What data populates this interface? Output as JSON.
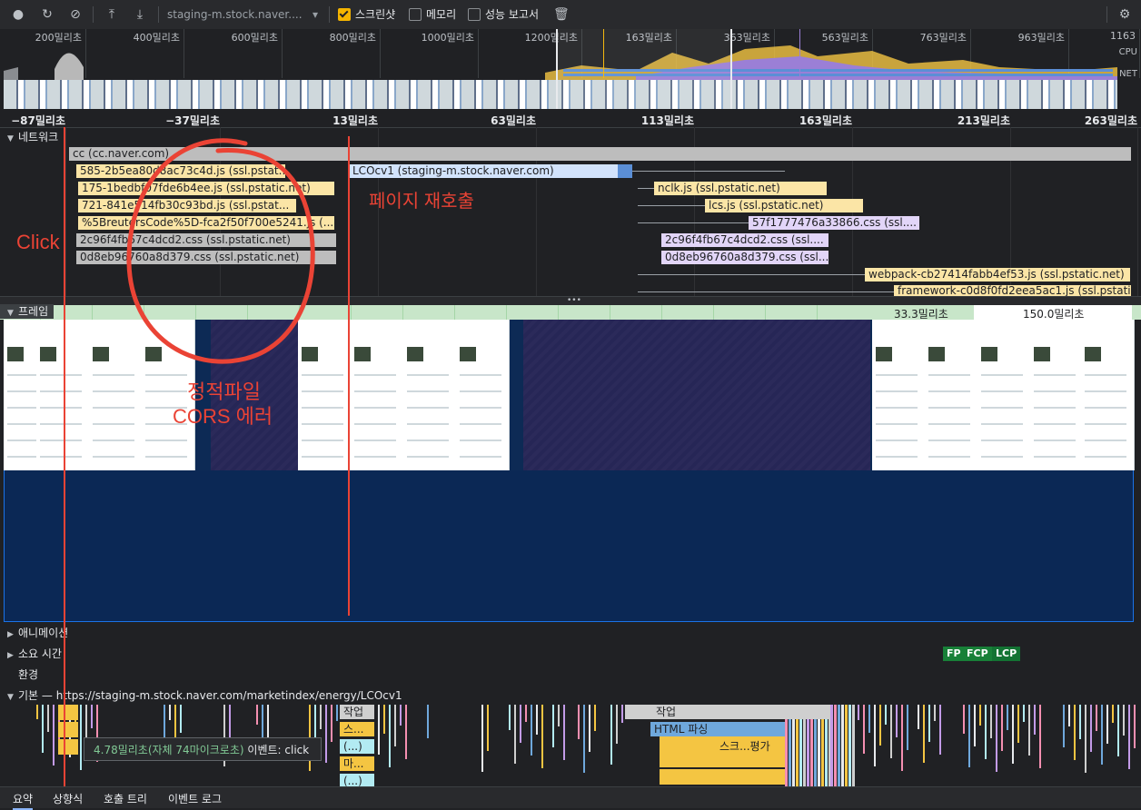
{
  "toolbar": {
    "url_select": "staging-m.stock.naver....",
    "screenshot_label": "스크린샷",
    "memory_label": "메모리",
    "perf_report_label": "성능 보고서"
  },
  "overview": {
    "ticks": [
      "200밀리초",
      "400밀리초",
      "600밀리초",
      "800밀리초",
      "1000밀리초",
      "1200밀리초",
      "163밀리초",
      "363밀리초",
      "563밀리초",
      "763밀리초",
      "963밀리초",
      "1163"
    ],
    "cpu_label": "CPU",
    "net_label": "NET"
  },
  "ruler": {
    "labels": [
      "−87밀리초",
      "−37밀리초",
      "13밀리초",
      "63밀리초",
      "113밀리초",
      "163밀리초",
      "213밀리초",
      "263밀리초"
    ]
  },
  "network": {
    "section_label": "네트워크",
    "requests": [
      {
        "label": "cc (cc.naver.com)"
      },
      {
        "label": "585-2b5ea80d8ac73c4d.js (ssl.pstat..."
      },
      {
        "label": "LCOcv1 (staging-m.stock.naver.com)"
      },
      {
        "label": "175-1bedbf07fde6b4ee.js (ssl.pstatic.net)"
      },
      {
        "label": "nclk.js (ssl.pstatic.net)"
      },
      {
        "label": "721-841e514fb30c93bd.js (ssl.pstat..."
      },
      {
        "label": "lcs.js (ssl.pstatic.net)"
      },
      {
        "label": "%5BreutersCode%5D-fca2f50f700e5241.js (..."
      },
      {
        "label": "57f1777476a33866.css (ssl...."
      },
      {
        "label": "2c96f4fb67c4dcd2.css (ssl.pstatic.net)"
      },
      {
        "label": "2c96f4fb67c4dcd2.css (ssl...."
      },
      {
        "label": "0d8eb96760a8d379.css (ssl.pstatic.net)"
      },
      {
        "label": "0d8eb96760a8d379.css (ssl...."
      },
      {
        "label": "webpack-cb27414fabb4ef53.js (ssl.pstatic.net)"
      },
      {
        "label": "framework-c0d8f0fd2eea5ac1.js (ssl.pstatic"
      }
    ]
  },
  "frames": {
    "section_label": "프레임",
    "label_a": "33.3밀리초",
    "label_b": "150.0밀리초"
  },
  "sections": {
    "animation": "애니메이션",
    "timings": "소요 시간",
    "environment": "환경",
    "main": "기본 — https://staging-m.stock.naver.com/marketindex/energy/LCOcv1"
  },
  "timing_chips": [
    "FP",
    "FCP",
    "LCP"
  ],
  "main_thread": {
    "task1_label": "작업",
    "task2_label": "작업",
    "html_parse_label": "HTML 파싱",
    "script_eval_label": "스크...평가",
    "sub1": "스...",
    "sub2": "(...)",
    "sub3": "마...",
    "sub4": "(...)"
  },
  "tooltip": {
    "duration": "4.78밀리초(자체 74마이크로초)",
    "event": "이벤트: click"
  },
  "annotations": {
    "click": "Click",
    "reload": "페이지 재호출",
    "cors_line1": "정적파일",
    "cors_line2": "CORS 에러"
  },
  "bottom_tabs": [
    "요약",
    "상향식",
    "호출 트리",
    "이벤트 로그"
  ],
  "colors": {
    "annotation_red": "#ea4335",
    "accent_blue": "#1a73e8",
    "fp_chip": "#188038"
  }
}
